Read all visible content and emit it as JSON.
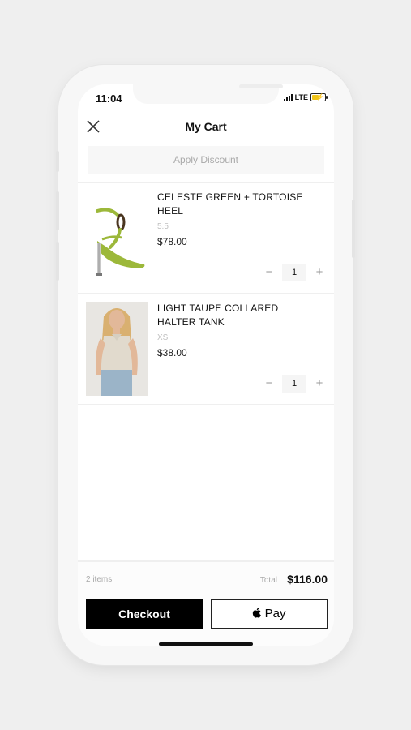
{
  "status_bar": {
    "time": "11:04",
    "network": "LTE"
  },
  "header": {
    "title": "My Cart",
    "close_icon": "close-icon"
  },
  "discount": {
    "label": "Apply Discount"
  },
  "cart_items": [
    {
      "name": "CELESTE GREEN + TORTOISE HEEL",
      "size": "5.5",
      "price": "$78.00",
      "quantity": "1",
      "image": "green-strappy-heel"
    },
    {
      "name": "LIGHT TAUPE COLLARED HALTER TANK",
      "size": "XS",
      "price": "$38.00",
      "quantity": "1",
      "image": "model-in-taupe-tank"
    }
  ],
  "qty_controls": {
    "minus": "−",
    "plus": "+"
  },
  "summary": {
    "items_count": "2 items",
    "total_label": "Total",
    "total_value": "$116.00"
  },
  "actions": {
    "checkout": "Checkout",
    "apple_pay": "Pay"
  },
  "colors": {
    "checkout_bg": "#000000",
    "price_text": "#222222",
    "muted_text": "#a9a9a9",
    "heel_green": "#9cb83a"
  }
}
